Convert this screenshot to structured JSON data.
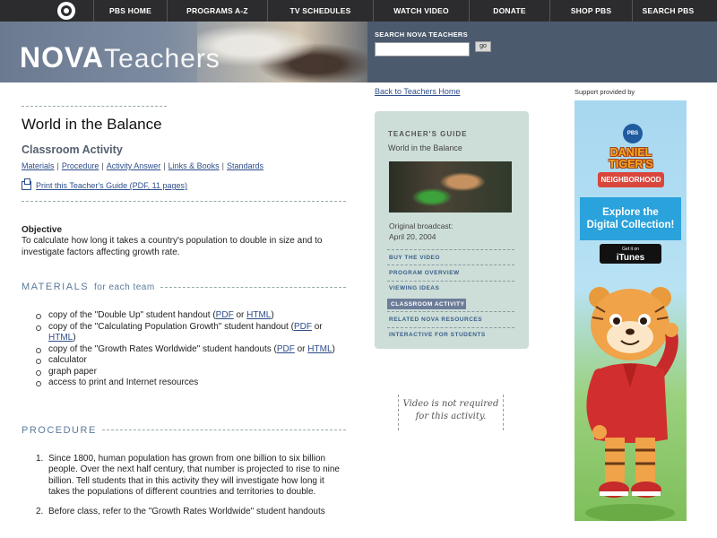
{
  "pbs_nav": {
    "logo": "pbs-logo",
    "items": [
      "PBS HOME",
      "PROGRAMS A-Z",
      "TV SCHEDULES",
      "WATCH VIDEO",
      "DONATE",
      "SHOP PBS",
      "SEARCH PBS"
    ]
  },
  "header": {
    "logo_bold": "NOVA",
    "logo_light": "Teachers",
    "search_label": "SEARCH NOVA TEACHERS",
    "search_value": "",
    "search_button": "go"
  },
  "back_link": "Back to Teachers Home",
  "main": {
    "title": "World in the Balance",
    "subtitle": "Classroom Activity",
    "tabs": [
      "Materials",
      "Procedure",
      "Activity Answer",
      "Links & Books",
      "Standards"
    ],
    "print_link": "Print this Teacher's Guide (PDF, 11 pages)",
    "objective_head": "Objective",
    "objective_text": "To calculate how long it takes a country's population to double in size and to investigate factors affecting growth rate.",
    "materials_head": "MATERIALS",
    "materials_sub": "for each team",
    "materials": [
      {
        "pre": "copy of the \"Double Up\" student handout (",
        "link1": "PDF",
        "mid": " or ",
        "link2": "HTML",
        "post": ")"
      },
      {
        "pre": "copy of the \"Calculating Population Growth\" student handout (",
        "link1": "PDF",
        "mid": " or ",
        "link2": "HTML",
        "post": ")"
      },
      {
        "pre": "copy of the \"Growth Rates Worldwide\" student handouts (",
        "link1": "PDF",
        "mid": " or ",
        "link2": "HTML",
        "post": ")"
      },
      {
        "pre": "calculator"
      },
      {
        "pre": "graph paper"
      },
      {
        "pre": "access to print and Internet resources"
      }
    ],
    "procedure_head": "PROCEDURE",
    "procedure": [
      {
        "num": "1.",
        "text": "Since 1800, human population has grown from one billion to six billion people. Over the next half century, that number is projected to rise to nine billion. Tell students that in this activity they will investigate how long it takes the populations of different countries and territories to double."
      },
      {
        "num": "2.",
        "text": "Before class, refer to the \"Growth Rates Worldwide\" student handouts"
      }
    ]
  },
  "guide": {
    "head": "TEACHER'S GUIDE",
    "title": "World in the Balance",
    "broadcast_label": "Original broadcast:",
    "broadcast_date": "April 20, 2004",
    "nav": [
      "BUY THE VIDEO",
      "PROGRAM OVERVIEW",
      "VIEWING IDEAS",
      "CLASSROOM ACTIVITY",
      "RELATED NOVA RESOURCES",
      "INTERACTIVE FOR STUDENTS"
    ],
    "active_index": 3
  },
  "video_note": "Video is not required for this activity.",
  "ad": {
    "label": "Support provided by",
    "pbs_kids": "PBS KIDS",
    "show_line1": "DANIEL",
    "show_line2": "TIGER'S",
    "show_line3": "NEIGHBORHOOD",
    "cta_line1": "Explore the",
    "cta_line2": "Digital Collection!",
    "store_small": "Get it on",
    "store_big": "iTunes"
  }
}
